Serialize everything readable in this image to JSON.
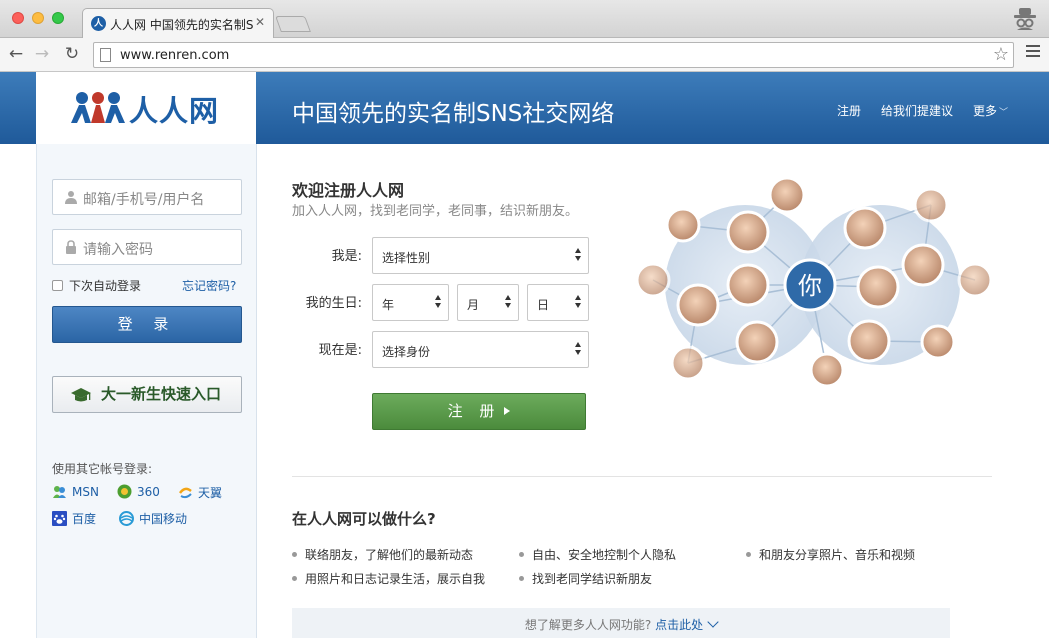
{
  "browser": {
    "tab_title": "人人网 中国领先的实名制SNS社交网络",
    "favicon_letter": "人",
    "url": "www.renren.com",
    "back_icon": "←",
    "forward_icon": "→",
    "reload_icon": "↻",
    "star_icon": "☆",
    "close_icon": "✕"
  },
  "header": {
    "logo_text": "人人网",
    "slogan": "中国领先的实名制SNS社交网络",
    "nav": {
      "register": "注册",
      "suggest": "给我们提建议",
      "more": "更多",
      "more_chevron": "﹀"
    }
  },
  "login": {
    "username_placeholder": "邮箱/手机号/用户名",
    "password_placeholder": "请输入密码",
    "remember": "下次自动登录",
    "forgot": "忘记密码?",
    "login_button": "登 录",
    "freshman_button": "大一新生快速入口",
    "other_title": "使用其它帐号登录:",
    "providers": {
      "msn": "MSN",
      "qihoo": "360",
      "tianyi": "天翼",
      "baidu": "百度",
      "cmcc": "中国移动"
    }
  },
  "register": {
    "title": "欢迎注册人人网",
    "subtitle": "加入人人网，找到老同学，老同事，结识新朋友。",
    "gender_label": "我是:",
    "gender_select": "选择性别",
    "birthday_label": "我的生日:",
    "year_select": "年",
    "month_select": "月",
    "day_select": "日",
    "identity_label": "现在是:",
    "identity_select": "选择身份",
    "register_button": "注 册"
  },
  "graphic": {
    "center_label": "你"
  },
  "features": {
    "title": "在人人网可以做什么?",
    "items": [
      "联络朋友，了解他们的最新动态",
      "自由、安全地控制个人隐私",
      "和朋友分享照片、音乐和视频",
      "用照片和日志记录生活，展示自我",
      "找到老同学结识新朋友"
    ],
    "more_text": "想了解更多人人网功能?",
    "more_link": "点击此处"
  },
  "colors": {
    "brand_blue": "#1e5fa6",
    "register_green": "#5a9a4a"
  }
}
